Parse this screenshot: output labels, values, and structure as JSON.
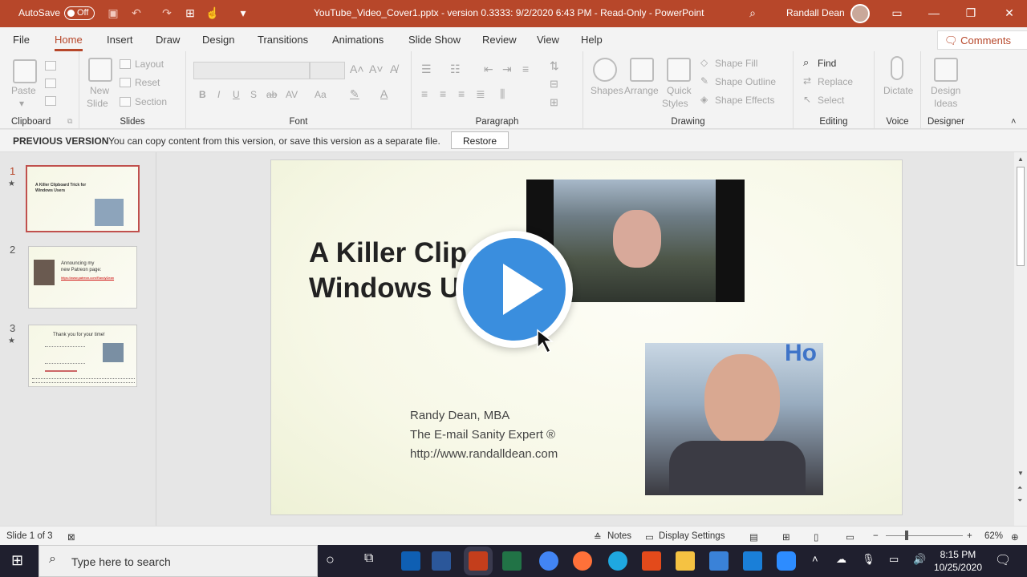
{
  "titlebar": {
    "autosave_label": "AutoSave",
    "autosave_state": "Off",
    "title": "YouTube_Video_Cover1.pptx  -  version 0.3333: 9/2/2020 6:43 PM  -  Read-Only  -  PowerPoint",
    "user": "Randall Dean",
    "accent_color": "#b7472a"
  },
  "tabs": [
    "File",
    "Home",
    "Insert",
    "Draw",
    "Design",
    "Transitions",
    "Animations",
    "Slide Show",
    "Review",
    "View",
    "Help"
  ],
  "active_tab": "Home",
  "comments_label": "Comments",
  "ribbon": {
    "clipboard": {
      "label": "Clipboard",
      "paste": "Paste"
    },
    "slides": {
      "label": "Slides",
      "new_slide_1": "New",
      "new_slide_2": "Slide",
      "layout": "Layout",
      "reset": "Reset",
      "section": "Section"
    },
    "font": {
      "label": "Font"
    },
    "paragraph": {
      "label": "Paragraph"
    },
    "drawing": {
      "label": "Drawing",
      "shapes": "Shapes",
      "arrange": "Arrange",
      "quick_styles_1": "Quick",
      "quick_styles_2": "Styles",
      "shape_fill": "Shape Fill",
      "shape_outline": "Shape Outline",
      "shape_effects": "Shape Effects"
    },
    "editing": {
      "label": "Editing",
      "find": "Find",
      "replace": "Replace",
      "select": "Select"
    },
    "voice": {
      "label": "Voice",
      "dictate": "Dictate"
    },
    "designer": {
      "label": "Designer",
      "design_ideas_1": "Design",
      "design_ideas_2": "Ideas"
    }
  },
  "infobar": {
    "title": "PREVIOUS VERSION",
    "message": "You can copy content from this version, or save this version as a separate file.",
    "button": "Restore"
  },
  "thumbnails": [
    {
      "number": "1",
      "lines": [
        "A Killer Clipboard Trick for",
        "Windows Users"
      ]
    },
    {
      "number": "2",
      "lines": [
        "Announcing my",
        "new Patreon page:",
        "https://www.patreon.com/RandyDean"
      ]
    },
    {
      "number": "3",
      "lines": [
        "Thank you for your time!"
      ]
    }
  ],
  "slide": {
    "title_line1": "A Killer Clip",
    "title_line2": "Windows U",
    "author": "Randy Dean, MBA",
    "tagline": "The E-mail Sanity Expert ®",
    "url": "http://www.randalldean.com",
    "photo_text": "Ho"
  },
  "status": {
    "slide_info": "Slide 1 of 3",
    "notes": "Notes",
    "display_settings": "Display Settings",
    "zoom": "62%"
  },
  "taskbar": {
    "search_placeholder": "Type here to search",
    "time": "8:15 PM",
    "date": "10/25/2020"
  }
}
